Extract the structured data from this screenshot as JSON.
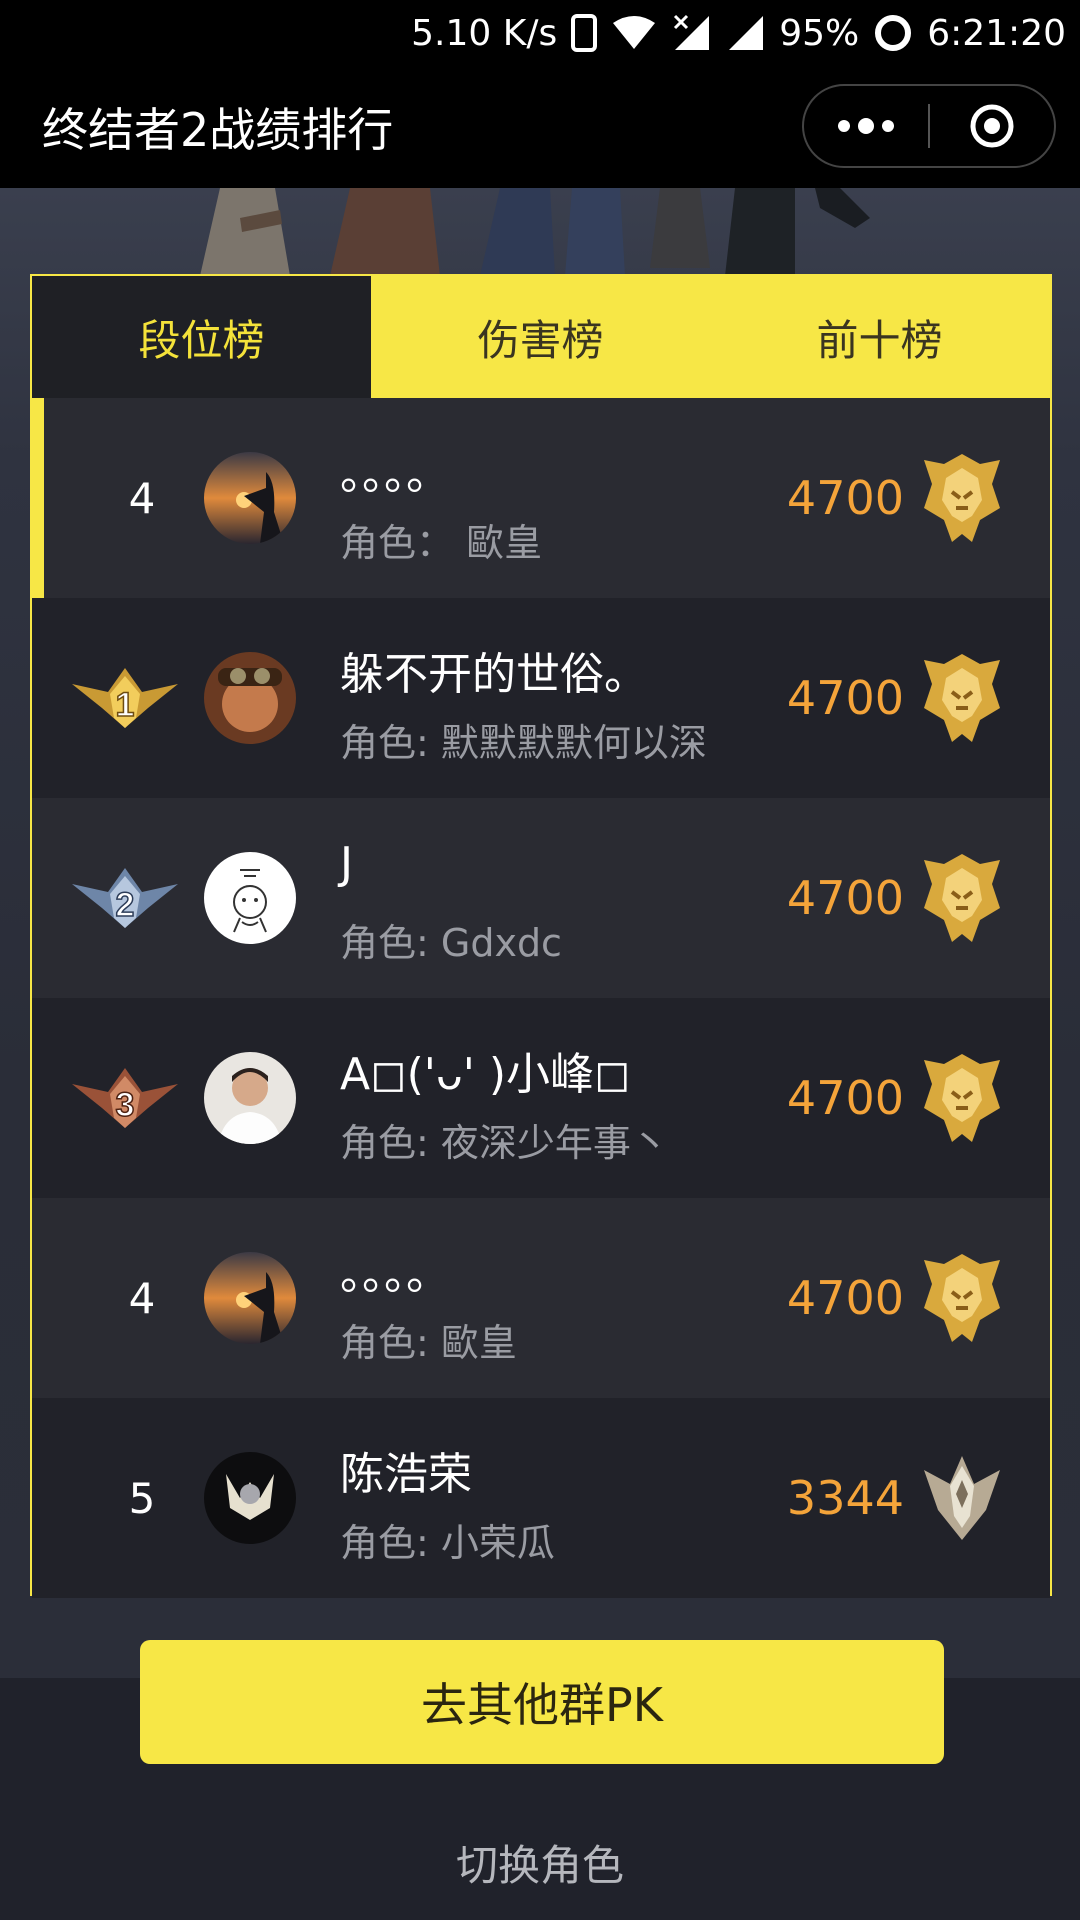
{
  "status_bar": {
    "speed": "5.10 K/s",
    "battery": "95%",
    "time": "6:21:20",
    "icons": [
      "phone-icon",
      "wifi-icon",
      "signal-off-icon",
      "signal-icon",
      "battery-ring-icon"
    ]
  },
  "header": {
    "title": "终结者2战绩排行",
    "icons": [
      "more-dots-icon",
      "target-icon"
    ]
  },
  "tabs": [
    {
      "label": "段位榜",
      "active": true
    },
    {
      "label": "伤害榜",
      "active": false
    },
    {
      "label": "前十榜",
      "active": false
    }
  ],
  "rows": [
    {
      "rank": "4",
      "medal": null,
      "name": "。。。。",
      "role": "角色：  歐皇",
      "score": "4700",
      "badge": "gold-lion-badge",
      "highlight": true
    },
    {
      "rank": "1",
      "medal": "gold",
      "name": "躲不开的世俗。",
      "role": "角色: 默默默默何以深",
      "score": "4700",
      "badge": "gold-lion-badge",
      "highlight": false
    },
    {
      "rank": "2",
      "medal": "silver",
      "name": "J",
      "role": "角色: Gdxdc",
      "score": "4700",
      "badge": "gold-lion-badge",
      "highlight": false
    },
    {
      "rank": "3",
      "medal": "bronze",
      "name": "A◻('ᴗ' )小峰◻",
      "role": "角色: 夜深少年事丶",
      "score": "4700",
      "badge": "gold-lion-badge",
      "highlight": false
    },
    {
      "rank": "4",
      "medal": null,
      "name": "。。。。",
      "role": "角色: 歐皇",
      "score": "4700",
      "badge": "gold-lion-badge",
      "highlight": false
    },
    {
      "rank": "5",
      "medal": null,
      "name": "陈浩荣",
      "role": "角色: 小荣瓜",
      "score": "3344",
      "badge": "silver-wing-badge",
      "highlight": false
    }
  ],
  "actions": {
    "pk_button": "去其他群PK",
    "switch_role": "切换角色"
  },
  "colors": {
    "accent": "#f7e746",
    "score": "#f4a43a",
    "background": "#2a2c34"
  }
}
